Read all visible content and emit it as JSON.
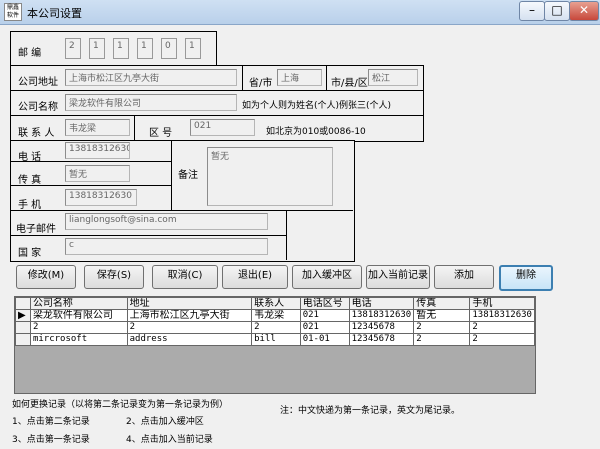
{
  "window": {
    "title": "本公司设置",
    "app_icon_text": "鼎鑫\n软件",
    "minimize": "–",
    "maximize": "□",
    "close": "✕"
  },
  "form": {
    "postcode_label": "邮  编",
    "postcode_digits": [
      "2",
      "1",
      "1",
      "1",
      "0",
      "1"
    ],
    "address_label": "公司地址",
    "address_value": "上海市松江区九亭大街",
    "province_label": "省/市",
    "province_value": "上海",
    "city_label": "市/县/区",
    "city_value": "松江",
    "company_label": "公司名称",
    "company_value": "梁龙软件有限公司",
    "company_hint": "如为个人则为姓名(个人)例张三(个人)",
    "contact_label": "联 系 人",
    "contact_value": "韦龙梁",
    "area_label": "区  号",
    "area_value": "021",
    "area_hint": "如北京为010或0086-10",
    "phone_label": "电  话",
    "phone_value": "13818312630",
    "fax_label": "传  真",
    "fax_value": "暂无",
    "mobile_label": "手  机",
    "mobile_value": "13818312630",
    "remark_label": "备注",
    "remark_value": "暂无",
    "email_label": "电子邮件",
    "email_value": "lianglongsoft@sina.com",
    "country_label": "国  家",
    "country_value": "c"
  },
  "buttons": {
    "modify": "修改(M)",
    "save": "保存(S)",
    "cancel": "取消(C)",
    "exit": "退出(E)",
    "add_buffer": "加入缓冲区",
    "add_current": "加入当前记录",
    "add": "添加",
    "delete": "删除"
  },
  "grid": {
    "columns": [
      "公司名称",
      "地址",
      "联系人",
      "电话区号",
      "电话",
      "传真",
      "手机"
    ],
    "rows": [
      [
        "梁龙软件有限公司",
        "上海市松江区九亭大街",
        "韦龙梁",
        "021",
        "13818312630",
        "暂无",
        "13818312630"
      ],
      [
        "2",
        "2",
        "2",
        "021",
        "12345678",
        "2",
        "2"
      ],
      [
        "mircrosoft",
        "address",
        "bill",
        "01-01",
        "12345678",
        "2",
        "2"
      ]
    ],
    "current_row_marker": "▶"
  },
  "notes": {
    "how_title": "如何更换记录（以将第二条记录变为第一条记录为例）",
    "step1": "1、点击第二条记录",
    "step2": "2、点击加入缓冲区",
    "step3": "3、点击第一条记录",
    "step4": "4、点击加入当前记录",
    "footnote": "注：中文快递为第一条记录，英文为尾记录。"
  }
}
